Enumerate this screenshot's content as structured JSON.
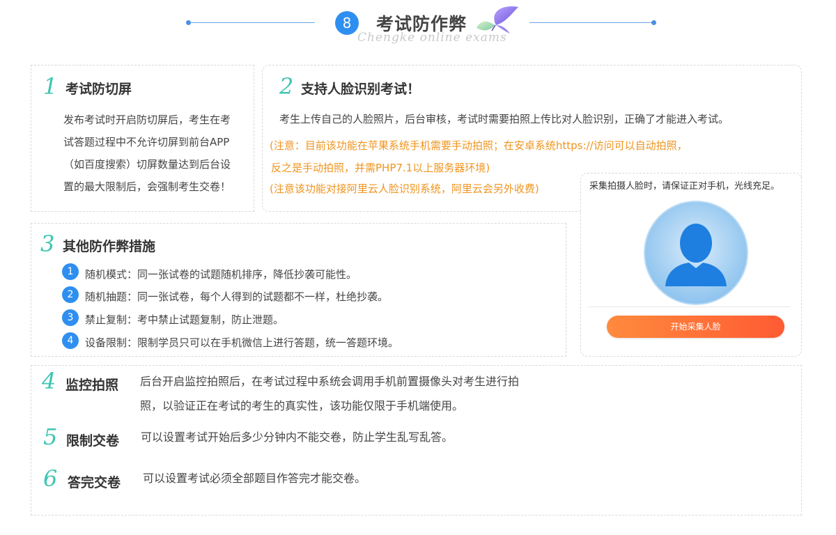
{
  "header": {
    "number": "8",
    "title": "考试防作弊",
    "subtitle": "Chengke online exams"
  },
  "sections": {
    "s1": {
      "number": "1",
      "title": "考试防切屏",
      "lines": [
        "发布考试时开启防切屏后，考生在考",
        "试答题过程中不允许切屏到前台APP",
        "（如百度搜索）切屏数量达到后台设",
        "置的最大限制后，会强制考生交卷！"
      ]
    },
    "s2": {
      "number": "2",
      "title": "支持人脸识别考试！",
      "text": "考生上传自己的人脸照片，后台审核，考试时需要拍照上传比对人脸识别，正确了才能进入考试。",
      "notes": [
        "(注意：目前该功能在苹果系统手机需要手动拍照；在安卓系统https://访问可以自动拍照，",
        "反之是手动拍照，并需PHP7.1以上服务器环境)",
        "(注意该功能对接阿里云人脸识别系统，阿里云会另外收费)"
      ]
    },
    "s3": {
      "number": "3",
      "title": "其他防作弊措施",
      "items": [
        {
          "num": "1",
          "text": "随机模式：同一张试卷的试题随机排序，降低抄袭可能性。"
        },
        {
          "num": "2",
          "text": "随机抽题：同一张试卷，每个人得到的试题都不一样，杜绝抄袭。"
        },
        {
          "num": "3",
          "text": "禁止复制：考中禁止试题复制，防止泄题。"
        },
        {
          "num": "4",
          "text": "设备限制：限制学员只可以在手机微信上进行答题，统一答题环境。"
        }
      ]
    },
    "s4": {
      "number": "4",
      "title": "监控拍照",
      "lines": [
        "后台开启监控拍照后，在考试过程中系统会调用手机前置摄像头对考生进行拍",
        "照，以验证正在考试的考生的真实性，该功能仅限于手机端使用。"
      ]
    },
    "s5": {
      "number": "5",
      "title": "限制交卷",
      "text": "可以设置考试开始后多少分钟内不能交卷，防止学生乱写乱答。"
    },
    "s6": {
      "number": "6",
      "title": "答完交卷",
      "text": "可以设置考试必须全部题目作答完才能交卷。"
    }
  },
  "face_panel": {
    "tip": "采集拍摄人脸时，请保证正对手机，光线充足。",
    "avatar_icon": "user-avatar-icon",
    "button_label": "开始采集人脸",
    "button_color_start": "#ff8a3d",
    "button_color_end": "#ff5b33"
  },
  "colors": {
    "accent_blue": "#2f8ff0",
    "number_teal": "#3cc6b2",
    "note_orange": "#f0941f"
  }
}
